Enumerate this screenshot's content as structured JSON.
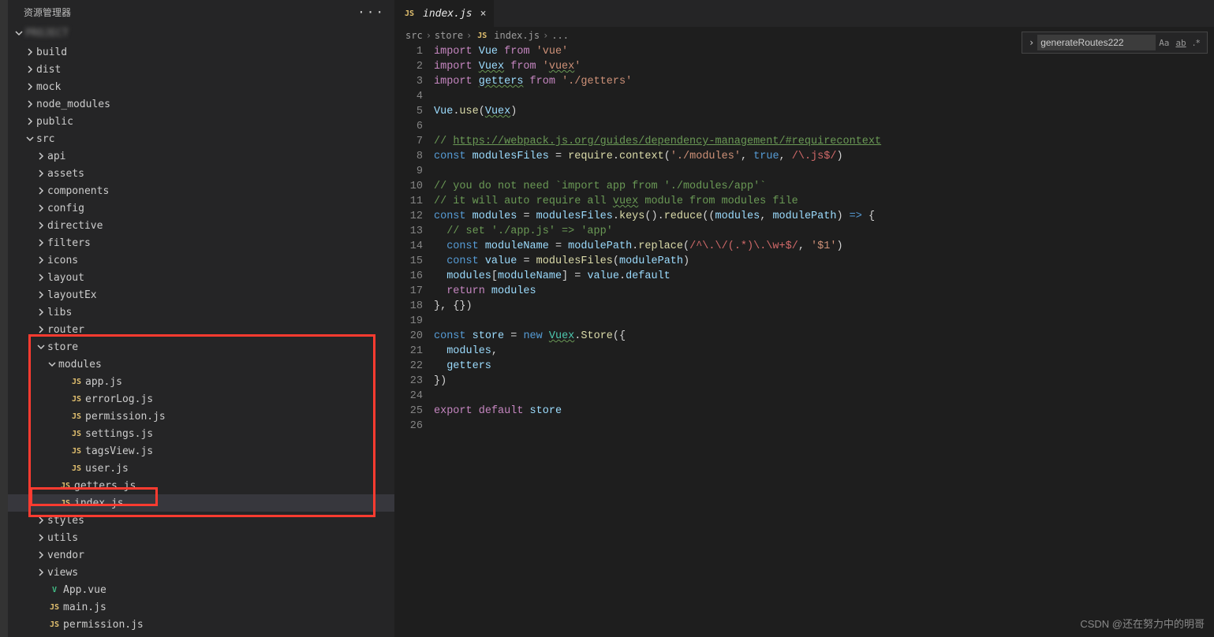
{
  "sidebar": {
    "title": "资源管理器",
    "project": "PROJECT",
    "tree": [
      {
        "type": "folder",
        "label": "build",
        "depth": 1,
        "open": false
      },
      {
        "type": "folder",
        "label": "dist",
        "depth": 1,
        "open": false
      },
      {
        "type": "folder",
        "label": "mock",
        "depth": 1,
        "open": false
      },
      {
        "type": "folder",
        "label": "node_modules",
        "depth": 1,
        "open": false
      },
      {
        "type": "folder",
        "label": "public",
        "depth": 1,
        "open": false
      },
      {
        "type": "folder",
        "label": "src",
        "depth": 1,
        "open": true
      },
      {
        "type": "folder",
        "label": "api",
        "depth": 2,
        "open": false
      },
      {
        "type": "folder",
        "label": "assets",
        "depth": 2,
        "open": false
      },
      {
        "type": "folder",
        "label": "components",
        "depth": 2,
        "open": false
      },
      {
        "type": "folder",
        "label": "config",
        "depth": 2,
        "open": false
      },
      {
        "type": "folder",
        "label": "directive",
        "depth": 2,
        "open": false
      },
      {
        "type": "folder",
        "label": "filters",
        "depth": 2,
        "open": false
      },
      {
        "type": "folder",
        "label": "icons",
        "depth": 2,
        "open": false
      },
      {
        "type": "folder",
        "label": "layout",
        "depth": 2,
        "open": false
      },
      {
        "type": "folder",
        "label": "layoutEx",
        "depth": 2,
        "open": false
      },
      {
        "type": "folder",
        "label": "libs",
        "depth": 2,
        "open": false
      },
      {
        "type": "folder",
        "label": "router",
        "depth": 2,
        "open": false
      },
      {
        "type": "folder",
        "label": "store",
        "depth": 2,
        "open": true
      },
      {
        "type": "folder",
        "label": "modules",
        "depth": 3,
        "open": true
      },
      {
        "type": "file",
        "label": "app.js",
        "depth": 4,
        "icon": "js"
      },
      {
        "type": "file",
        "label": "errorLog.js",
        "depth": 4,
        "icon": "js"
      },
      {
        "type": "file",
        "label": "permission.js",
        "depth": 4,
        "icon": "js"
      },
      {
        "type": "file",
        "label": "settings.js",
        "depth": 4,
        "icon": "js"
      },
      {
        "type": "file",
        "label": "tagsView.js",
        "depth": 4,
        "icon": "js"
      },
      {
        "type": "file",
        "label": "user.js",
        "depth": 4,
        "icon": "js"
      },
      {
        "type": "file",
        "label": "getters.js",
        "depth": 3,
        "icon": "js"
      },
      {
        "type": "file",
        "label": "index.js",
        "depth": 3,
        "icon": "js",
        "selected": true
      },
      {
        "type": "folder",
        "label": "styles",
        "depth": 2,
        "open": false
      },
      {
        "type": "folder",
        "label": "utils",
        "depth": 2,
        "open": false
      },
      {
        "type": "folder",
        "label": "vendor",
        "depth": 2,
        "open": false
      },
      {
        "type": "folder",
        "label": "views",
        "depth": 2,
        "open": false
      },
      {
        "type": "file",
        "label": "App.vue",
        "depth": 2,
        "icon": "vue"
      },
      {
        "type": "file",
        "label": "main.js",
        "depth": 2,
        "icon": "js"
      },
      {
        "type": "file",
        "label": "permission.js",
        "depth": 2,
        "icon": "js"
      }
    ]
  },
  "tab": {
    "icon": "JS",
    "label": "index.js"
  },
  "breadcrumb": {
    "parts": [
      "src",
      "store"
    ],
    "fileIcon": "JS",
    "file": "index.js",
    "tail": "..."
  },
  "find": {
    "value": "generateRoutes222",
    "opts": [
      "Aa",
      "ab",
      "․*"
    ]
  },
  "code": {
    "lines": [
      [
        {
          "c": "c-kw",
          "t": "import"
        },
        {
          "t": " "
        },
        {
          "c": "c-var",
          "t": "Vue"
        },
        {
          "t": " "
        },
        {
          "c": "c-kw",
          "t": "from"
        },
        {
          "t": " "
        },
        {
          "c": "c-str",
          "t": "'vue'"
        }
      ],
      [
        {
          "c": "c-kw",
          "t": "import"
        },
        {
          "t": " "
        },
        {
          "c": "c-var underl",
          "t": "Vuex"
        },
        {
          "t": " "
        },
        {
          "c": "c-kw",
          "t": "from"
        },
        {
          "t": " "
        },
        {
          "c": "c-str",
          "t": "'"
        },
        {
          "c": "c-str underl",
          "t": "vuex"
        },
        {
          "c": "c-str",
          "t": "'"
        }
      ],
      [
        {
          "c": "c-kw",
          "t": "import"
        },
        {
          "t": " "
        },
        {
          "c": "c-var underl",
          "t": "getters"
        },
        {
          "t": " "
        },
        {
          "c": "c-kw",
          "t": "from"
        },
        {
          "t": " "
        },
        {
          "c": "c-str",
          "t": "'./getters'"
        }
      ],
      [],
      [
        {
          "c": "c-var",
          "t": "Vue"
        },
        {
          "t": "."
        },
        {
          "c": "c-fn",
          "t": "use"
        },
        {
          "t": "("
        },
        {
          "c": "c-var underl",
          "t": "Vuex"
        },
        {
          "t": ")"
        }
      ],
      [],
      [
        {
          "c": "c-com",
          "t": "// "
        },
        {
          "c": "c-link",
          "t": "https://webpack.js.org/guides/dependency-management/#requirecontext"
        }
      ],
      [
        {
          "c": "c-const",
          "t": "const"
        },
        {
          "t": " "
        },
        {
          "c": "c-var",
          "t": "modulesFiles"
        },
        {
          "t": " = "
        },
        {
          "c": "c-fn",
          "t": "require"
        },
        {
          "t": "."
        },
        {
          "c": "c-fn",
          "t": "context"
        },
        {
          "t": "("
        },
        {
          "c": "c-str",
          "t": "'./modules'"
        },
        {
          "t": ", "
        },
        {
          "c": "c-const",
          "t": "true"
        },
        {
          "t": ", "
        },
        {
          "c": "c-re",
          "t": "/\\.js$/"
        },
        {
          "t": ")"
        }
      ],
      [],
      [
        {
          "c": "c-com",
          "t": "// you do not need `import app from './modules/app'`"
        }
      ],
      [
        {
          "c": "c-com",
          "t": "// it will auto require all "
        },
        {
          "c": "c-com underl",
          "t": "vuex"
        },
        {
          "c": "c-com",
          "t": " module from modules file"
        }
      ],
      [
        {
          "c": "c-const",
          "t": "const"
        },
        {
          "t": " "
        },
        {
          "c": "c-var",
          "t": "modules"
        },
        {
          "t": " = "
        },
        {
          "c": "c-var",
          "t": "modulesFiles"
        },
        {
          "t": "."
        },
        {
          "c": "c-fn",
          "t": "keys"
        },
        {
          "t": "()."
        },
        {
          "c": "c-fn",
          "t": "reduce"
        },
        {
          "t": "(("
        },
        {
          "c": "c-var",
          "t": "modules"
        },
        {
          "t": ", "
        },
        {
          "c": "c-var",
          "t": "modulePath"
        },
        {
          "t": ") "
        },
        {
          "c": "c-const",
          "t": "=>"
        },
        {
          "t": " {"
        }
      ],
      [
        {
          "t": "  "
        },
        {
          "c": "c-com",
          "t": "// set './app.js' => 'app'"
        }
      ],
      [
        {
          "t": "  "
        },
        {
          "c": "c-const",
          "t": "const"
        },
        {
          "t": " "
        },
        {
          "c": "c-var",
          "t": "moduleName"
        },
        {
          "t": " = "
        },
        {
          "c": "c-var",
          "t": "modulePath"
        },
        {
          "t": "."
        },
        {
          "c": "c-fn",
          "t": "replace"
        },
        {
          "t": "("
        },
        {
          "c": "c-re",
          "t": "/^\\.\\/(.*)\\.\\w+$/"
        },
        {
          "t": ", "
        },
        {
          "c": "c-str",
          "t": "'$1'"
        },
        {
          "t": ")"
        }
      ],
      [
        {
          "t": "  "
        },
        {
          "c": "c-const",
          "t": "const"
        },
        {
          "t": " "
        },
        {
          "c": "c-var",
          "t": "value"
        },
        {
          "t": " = "
        },
        {
          "c": "c-fn",
          "t": "modulesFiles"
        },
        {
          "t": "("
        },
        {
          "c": "c-var",
          "t": "modulePath"
        },
        {
          "t": ")"
        }
      ],
      [
        {
          "t": "  "
        },
        {
          "c": "c-var",
          "t": "modules"
        },
        {
          "t": "["
        },
        {
          "c": "c-var",
          "t": "moduleName"
        },
        {
          "t": "] = "
        },
        {
          "c": "c-var",
          "t": "value"
        },
        {
          "t": "."
        },
        {
          "c": "c-var",
          "t": "default"
        }
      ],
      [
        {
          "t": "  "
        },
        {
          "c": "c-kw",
          "t": "return"
        },
        {
          "t": " "
        },
        {
          "c": "c-var",
          "t": "modules"
        }
      ],
      [
        {
          "t": "}, {})"
        }
      ],
      [],
      [
        {
          "c": "c-const",
          "t": "const"
        },
        {
          "t": " "
        },
        {
          "c": "c-var",
          "t": "store"
        },
        {
          "t": " = "
        },
        {
          "c": "c-const",
          "t": "new"
        },
        {
          "t": " "
        },
        {
          "c": "c-type underl",
          "t": "Vuex"
        },
        {
          "t": "."
        },
        {
          "c": "c-fn",
          "t": "Store"
        },
        {
          "t": "({"
        }
      ],
      [
        {
          "t": "  "
        },
        {
          "c": "c-var",
          "t": "modules"
        },
        {
          "t": ","
        }
      ],
      [
        {
          "t": "  "
        },
        {
          "c": "c-var",
          "t": "getters"
        }
      ],
      [
        {
          "t": "})"
        }
      ],
      [],
      [
        {
          "c": "c-kw",
          "t": "export"
        },
        {
          "t": " "
        },
        {
          "c": "c-kw",
          "t": "default"
        },
        {
          "t": " "
        },
        {
          "c": "c-var",
          "t": "store"
        }
      ],
      []
    ]
  },
  "watermark": "CSDN @还在努力中的明哥"
}
